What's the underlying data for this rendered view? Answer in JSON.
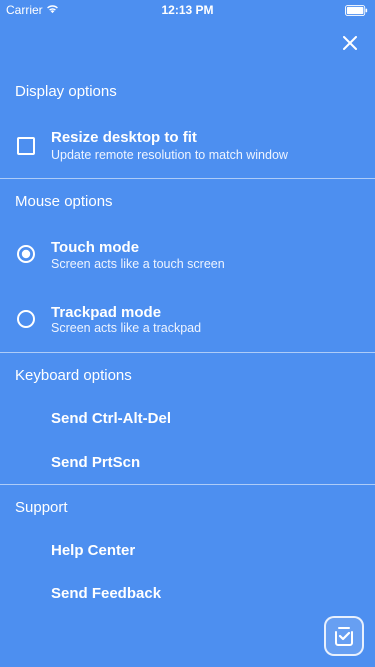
{
  "status_bar": {
    "carrier": "Carrier",
    "time": "12:13 PM"
  },
  "sections": {
    "display": {
      "title": "Display options",
      "resize": {
        "title": "Resize desktop to fit",
        "subtitle": "Update remote resolution to match window",
        "checked": false
      }
    },
    "mouse": {
      "title": "Mouse options",
      "touch": {
        "title": "Touch mode",
        "subtitle": "Screen acts like a touch screen",
        "selected": true
      },
      "trackpad": {
        "title": "Trackpad mode",
        "subtitle": "Screen acts like a trackpad",
        "selected": false
      }
    },
    "keyboard": {
      "title": "Keyboard options",
      "ctrl_alt_del": "Send Ctrl-Alt-Del",
      "prtscn": "Send PrtScn"
    },
    "support": {
      "title": "Support",
      "help_center": "Help Center",
      "send_feedback": "Send Feedback"
    }
  },
  "colors": {
    "background": "#4d8ff0",
    "text": "#ffffff"
  }
}
